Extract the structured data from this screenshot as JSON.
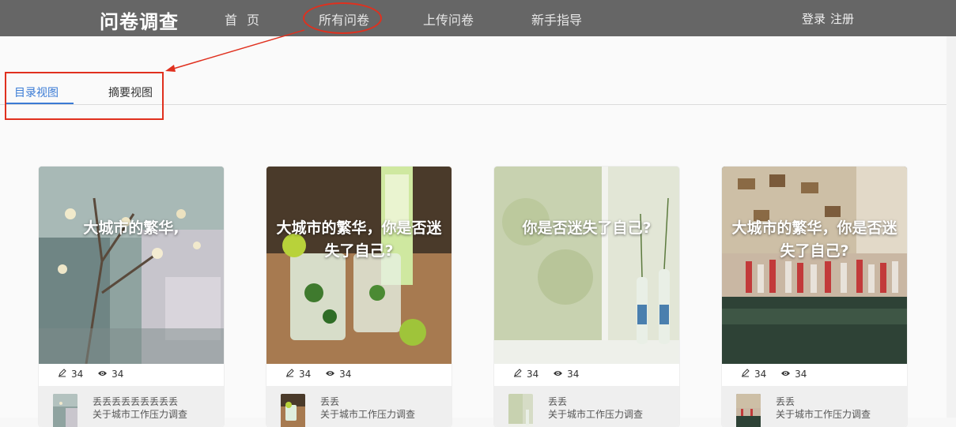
{
  "header": {
    "brand": "问卷调查",
    "nav": [
      "首页",
      "所有问卷",
      "上传问卷",
      "新手指导"
    ],
    "login": "登录",
    "register": "注册"
  },
  "tabs": [
    {
      "label": "目录视图",
      "active": true
    },
    {
      "label": "摘要视图",
      "active": false
    }
  ],
  "colors": {
    "topbar": "#666666",
    "accent": "#3a7bd5",
    "annotation": "#e0301e"
  },
  "cards": [
    {
      "title": "大城市的繁华,",
      "edits": "34",
      "views": "34",
      "author": "丢丢丢丢丢丢丢丢丢",
      "subtitle": "关于城市工作压力调查"
    },
    {
      "title": "大城市的繁华，你是否迷失了自己?",
      "edits": "34",
      "views": "34",
      "author": "丢丢",
      "subtitle": "关于城市工作压力调查"
    },
    {
      "title": "你是否迷失了自己?",
      "edits": "34",
      "views": "34",
      "author": "丢丢",
      "subtitle": "关于城市工作压力调查"
    },
    {
      "title": "大城市的繁华，你是否迷失了自己?",
      "edits": "34",
      "views": "34",
      "author": "丢丢",
      "subtitle": "关于城市工作压力调查"
    }
  ],
  "icons": {
    "edit": "pencil-icon",
    "view": "eye-icon"
  }
}
